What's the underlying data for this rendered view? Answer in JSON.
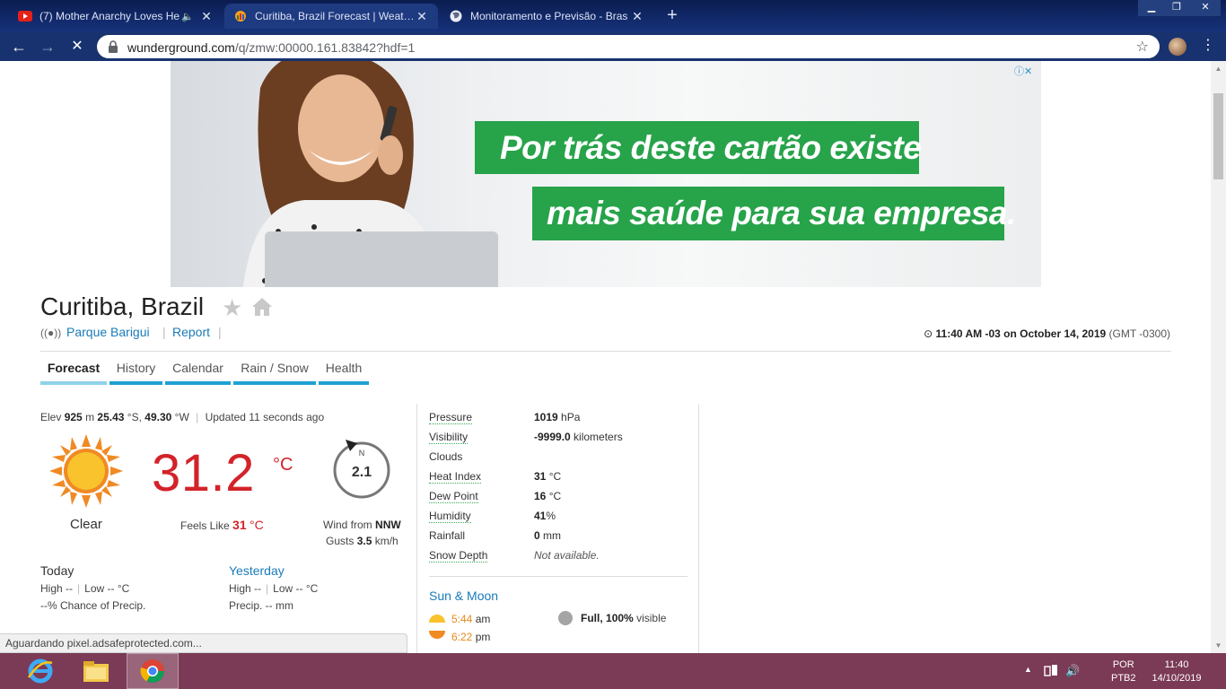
{
  "browser": {
    "tabs": [
      {
        "title": "(7) Mother Anarchy Loves He",
        "icon": "youtube-icon",
        "audio": true
      },
      {
        "title": "Curitiba, Brazil Forecast | Weathe",
        "icon": "wunderground-icon"
      },
      {
        "title": "Monitoramento e Previsão - Bras",
        "icon": "globe-icon"
      }
    ],
    "new_tab": "+",
    "url_host": "wunderground.com",
    "url_path": "/q/zmw:00000.161.83842?hdf=1"
  },
  "ad": {
    "line1": "Por trás deste cartão existe",
    "line2": "mais saúde para sua empresa.",
    "choices": "ⓘ✕"
  },
  "location": {
    "city": "Curitiba, Brazil",
    "station": "Parque Barigui",
    "report": "Report",
    "time_bold": "11:40 AM -03 on October 14, 2019",
    "gmt": "(GMT -0300)"
  },
  "nav_tabs": [
    "Forecast",
    "History",
    "Calendar",
    "Rain / Snow",
    "Health"
  ],
  "current": {
    "elev_label": "Elev",
    "elev_value": "925",
    "elev_unit": "m",
    "lat": "25.43",
    "lat_dir": "°S,",
    "lon": "49.30",
    "lon_dir": "°W",
    "updated": "Updated 11 seconds ago",
    "condition": "Clear",
    "temp": "31.2",
    "temp_unit": "°C",
    "feels_label": "Feels Like",
    "feels_value": "31",
    "feels_unit": "°C",
    "wind_speed": "2.1",
    "wind_compass": "N",
    "wind_from_label": "Wind from",
    "wind_dir": "NNW",
    "gusts_label": "Gusts",
    "gusts_value": "3.5",
    "gusts_unit": "km/h"
  },
  "today": {
    "title": "Today",
    "high": "High --",
    "low": "Low -- °C",
    "precip": "--% Chance of Precip."
  },
  "yesterday": {
    "title": "Yesterday",
    "high": "High --",
    "low": "Low -- °C",
    "precip": "Precip. -- mm"
  },
  "details": [
    {
      "label": "Pressure",
      "value": "1019",
      "unit": "hPa",
      "dotted": true
    },
    {
      "label": "Visibility",
      "value": "-9999.0",
      "unit": "kilometers",
      "dotted": true
    },
    {
      "label": "Clouds",
      "value": "",
      "unit": "",
      "dotted": false
    },
    {
      "label": "Heat Index",
      "value": "31",
      "unit": "°C",
      "dotted": true
    },
    {
      "label": "Dew Point",
      "value": "16",
      "unit": "°C",
      "dotted": true
    },
    {
      "label": "Humidity",
      "value": "41",
      "unit": "%",
      "dotted": true
    },
    {
      "label": "Rainfall",
      "value": "0",
      "unit": "mm",
      "dotted": false
    },
    {
      "label": "Snow Depth",
      "value": "",
      "unit": "",
      "note": "Not available.",
      "dotted": true
    }
  ],
  "sun_moon": {
    "title": "Sun & Moon",
    "sunrise": "5:44",
    "sunrise_suffix": "am",
    "sunset": "6:22",
    "sunset_suffix": "pm",
    "moon_phase": "Full,",
    "moon_pct": "100%",
    "moon_visible": "visible"
  },
  "status": "Aguardando pixel.adsafeprotected.com...",
  "taskbar": {
    "lang1": "POR",
    "lang2": "PTB2",
    "time": "11:40",
    "date": "14/10/2019"
  },
  "colors": {
    "temp_red": "#d3232a",
    "link_blue": "#1a7bb8",
    "tab_bar": "#1ea2d2",
    "ad_green": "#27a34a",
    "taskbar": "#7b3a55"
  }
}
